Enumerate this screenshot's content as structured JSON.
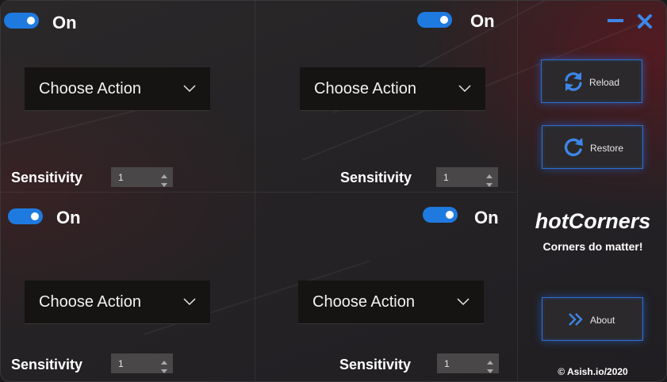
{
  "window": {
    "controls": {
      "minimize_icon": "minimize-icon",
      "close_icon": "close-icon"
    }
  },
  "corners": [
    {
      "id": "top-left",
      "toggle": {
        "state": true,
        "label": "On"
      },
      "action": {
        "selected": "Choose Action"
      },
      "sensitivity": {
        "label": "Sensitivity",
        "value": "1"
      }
    },
    {
      "id": "top-right",
      "toggle": {
        "state": true,
        "label": "On"
      },
      "action": {
        "selected": "Choose Action"
      },
      "sensitivity": {
        "label": "Sensitivity",
        "value": "1"
      }
    },
    {
      "id": "bottom-left",
      "toggle": {
        "state": true,
        "label": "On"
      },
      "action": {
        "selected": "Choose Action"
      },
      "sensitivity": {
        "label": "Sensitivity",
        "value": "1"
      }
    },
    {
      "id": "bottom-right",
      "toggle": {
        "state": true,
        "label": "On"
      },
      "action": {
        "selected": "Choose Action"
      },
      "sensitivity": {
        "label": "Sensitivity",
        "value": "1"
      }
    }
  ],
  "sidebar": {
    "reload": {
      "label": "Reload",
      "icon": "refresh-icon"
    },
    "restore": {
      "label": "Restore",
      "icon": "restore-icon"
    },
    "app_title": "hotCorners",
    "tagline": "Corners do matter!",
    "about": {
      "label": "About",
      "icon": "double-chevron-right-icon"
    },
    "copyright": "© Asish.io/2020"
  },
  "colors": {
    "accent": "#1f7ae0",
    "button_border": "#2f6fd0",
    "background": "#262426",
    "dropdown_bg": "#161313"
  }
}
